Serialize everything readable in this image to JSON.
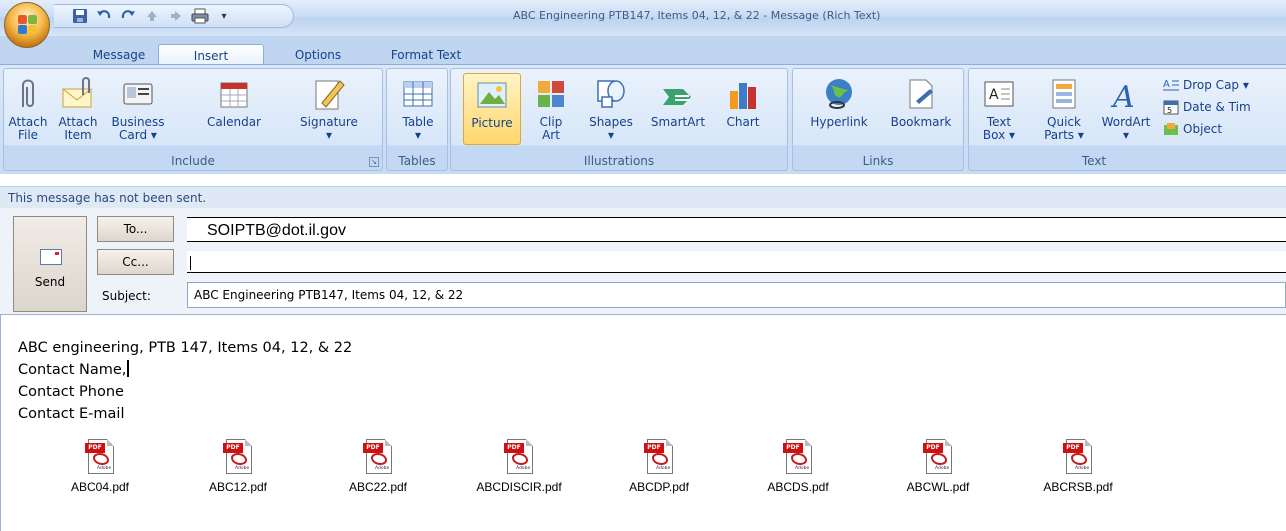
{
  "window": {
    "title": "ABC Engineering PTB147, Items 04, 12, & 22 - Message (Rich Text)"
  },
  "tabs": [
    {
      "label": "Message",
      "active": false
    },
    {
      "label": "Insert",
      "active": true
    },
    {
      "label": "Options",
      "active": false
    },
    {
      "label": "Format Text",
      "active": false
    }
  ],
  "ribbon": {
    "include": {
      "label": "Include",
      "attach_file": [
        "Attach",
        "File"
      ],
      "attach_item": [
        "Attach",
        "Item"
      ],
      "business_card": [
        "Business",
        "Card ▾"
      ],
      "calendar": "Calendar",
      "signature": "Signature",
      "signature_arrow": "▾"
    },
    "tables": {
      "label": "Tables",
      "table": "Table",
      "table_arrow": "▾"
    },
    "illustrations": {
      "label": "Illustrations",
      "picture": "Picture",
      "clip_art": [
        "Clip",
        "Art"
      ],
      "shapes": "Shapes",
      "shapes_arrow": "▾",
      "smartart": "SmartArt",
      "chart": "Chart"
    },
    "links": {
      "label": "Links",
      "hyperlink": "Hyperlink",
      "bookmark": "Bookmark"
    },
    "text": {
      "label": "Text",
      "text_box": [
        "Text",
        "Box ▾"
      ],
      "quick_parts": [
        "Quick",
        "Parts ▾"
      ],
      "wordart": "WordArt",
      "wordart_arrow": "▾",
      "drop_cap": "Drop Cap ▾",
      "date_time": "Date & Tim",
      "object": "Object"
    }
  },
  "info_bar": "This message has not been sent.",
  "compose": {
    "send_label": "Send",
    "to_label": "To...",
    "cc_label": "Cc...",
    "subject_label": "Subject:",
    "to_value": "SOIPTB@dot.il.gov",
    "cc_value": "",
    "subject_value": "ABC Engineering PTB147, Items 04, 12, & 22"
  },
  "body": {
    "line1": "ABC engineering, PTB 147, Items 04, 12, & 22",
    "line2": "Contact Name,",
    "line3": "Contact Phone",
    "line4": "Contact E-mail"
  },
  "attachments": [
    {
      "name": "ABC04.pdf"
    },
    {
      "name": "ABC12.pdf"
    },
    {
      "name": "ABC22.pdf"
    },
    {
      "name": "ABCDISCIR.pdf"
    },
    {
      "name": "ABCDP.pdf"
    },
    {
      "name": "ABCDS.pdf"
    },
    {
      "name": "ABCWL.pdf"
    },
    {
      "name": "ABCRSB.pdf"
    }
  ],
  "icons": {
    "pdf_tag": "PDF",
    "adobe": "Adobe"
  },
  "colors": {
    "ribbon_text": "#15428b",
    "active_button": "#ffd66c",
    "pdf_red": "#d01010"
  }
}
